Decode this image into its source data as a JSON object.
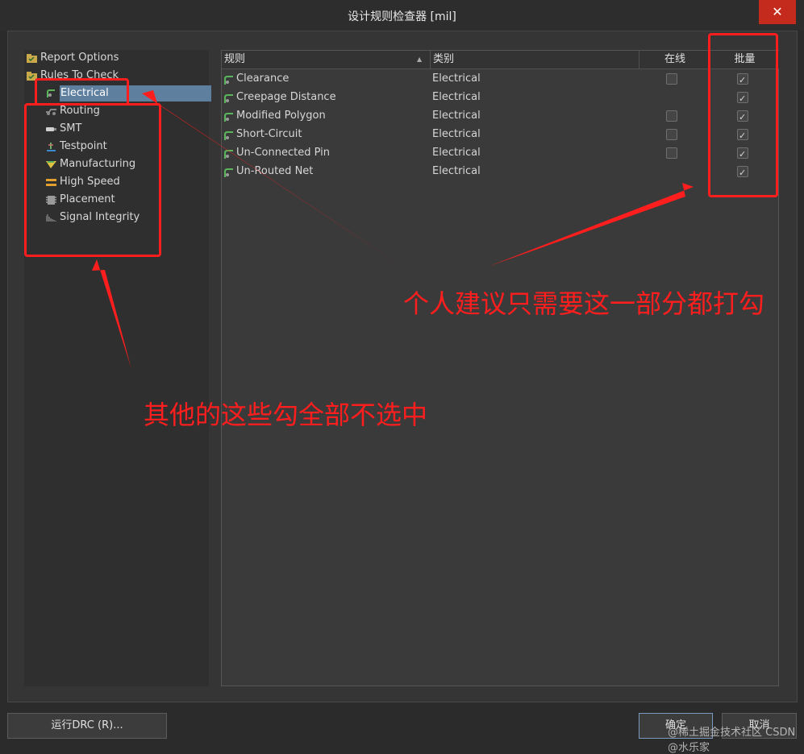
{
  "window": {
    "title": "设计规则检查器 [mil]",
    "close_glyph": "✕"
  },
  "tree": {
    "items": [
      {
        "label": "Report Options",
        "icon": "folder-check-icon"
      },
      {
        "label": "Rules To Check",
        "icon": "folder-check-icon"
      },
      {
        "label": "Electrical",
        "icon": "electrical-rule-icon"
      },
      {
        "label": "Routing",
        "icon": "routing-rule-icon"
      },
      {
        "label": "SMT",
        "icon": "smt-rule-icon"
      },
      {
        "label": "Testpoint",
        "icon": "testpoint-rule-icon"
      },
      {
        "label": "Manufacturing",
        "icon": "manufacturing-rule-icon"
      },
      {
        "label": "High Speed",
        "icon": "high-speed-rule-icon"
      },
      {
        "label": "Placement",
        "icon": "placement-rule-icon"
      },
      {
        "label": "Signal Integrity",
        "icon": "signal-integrity-rule-icon"
      }
    ]
  },
  "grid": {
    "headers": {
      "rule": "规则",
      "category": "类别",
      "online": "在线",
      "batch": "批量"
    },
    "rows": [
      {
        "rule": "Clearance",
        "category": "Electrical",
        "online": false,
        "batch": true
      },
      {
        "rule": "Creepage Distance",
        "category": "Electrical",
        "online": null,
        "batch": true
      },
      {
        "rule": "Modified Polygon",
        "category": "Electrical",
        "online": false,
        "batch": true
      },
      {
        "rule": "Short-Circuit",
        "category": "Electrical",
        "online": false,
        "batch": true
      },
      {
        "rule": "Un-Connected Pin",
        "category": "Electrical",
        "online": false,
        "batch": true
      },
      {
        "rule": "Un-Routed Net",
        "category": "Electrical",
        "online": null,
        "batch": true
      }
    ]
  },
  "buttons": {
    "run_drc": "运行DRC (R)...",
    "ok": "确定",
    "cancel": "取消"
  },
  "annotations": {
    "right_note": "个人建议只需要这一部分都打勾",
    "left_note": "其他的这些勾全部不选中",
    "color": "#ff1e1e"
  },
  "watermark": "@稀土掘金技术社区 CSDN @水乐家"
}
